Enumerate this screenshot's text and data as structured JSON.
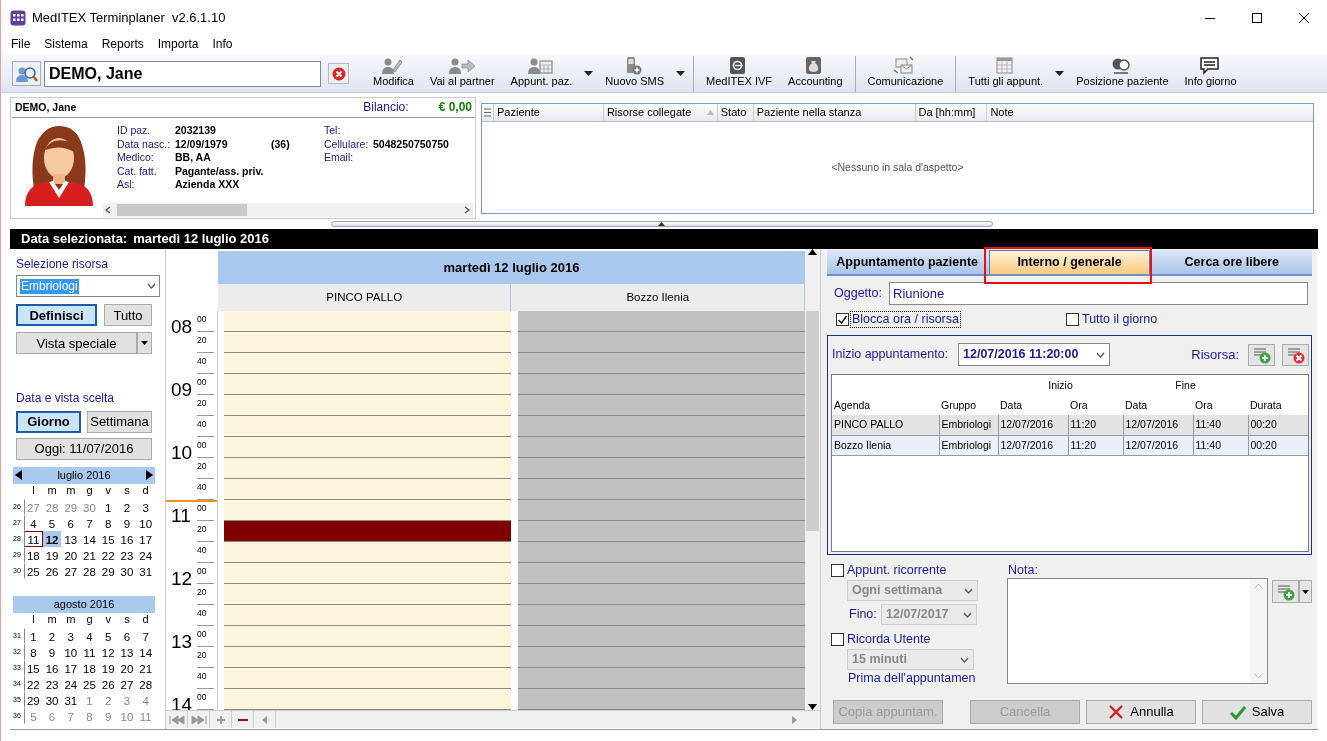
{
  "window": {
    "title": "MedITEX Terminplaner  v2.6.1.10"
  },
  "menu": [
    "File",
    "Sistema",
    "Reports",
    "Importa",
    "Info"
  ],
  "search": {
    "value": "DEMO, Jane"
  },
  "toolbar": [
    {
      "buttons": [
        {
          "label": "Modifica",
          "dropdown": false
        },
        {
          "label": "Vai al partner",
          "dropdown": false
        },
        {
          "label": "Appunt. paz.",
          "dropdown": true
        },
        {
          "label": "Nuovo SMS",
          "dropdown": true
        }
      ]
    },
    {
      "buttons": [
        {
          "label": "MedITEX IVF",
          "dropdown": false
        },
        {
          "label": "Accounting",
          "dropdown": false
        }
      ]
    },
    {
      "buttons": [
        {
          "label": "Comunicazione",
          "dropdown": false
        }
      ]
    },
    {
      "buttons": [
        {
          "label": "Tutti gli appunt.",
          "dropdown": true
        },
        {
          "label": "Posizione paziente",
          "dropdown": false
        },
        {
          "label": "Info giorno",
          "dropdown": false
        }
      ]
    }
  ],
  "patient": {
    "name": "DEMO, Jane",
    "balance_label": "Bilancio:",
    "balance": "€ 0,00",
    "details": [
      {
        "label": "ID paz.",
        "value": "2032139"
      },
      {
        "label": "Data nasc.:",
        "value": "12/09/1979",
        "extra": "(36)"
      },
      {
        "label": "Medico:",
        "value": "BB, AA"
      },
      {
        "label": "Cat. fatt.",
        "value": "Pagante/ass. priv."
      },
      {
        "label": "Asl:",
        "value": "Azienda XXX"
      }
    ],
    "contacts": [
      {
        "label": "Tel:"
      },
      {
        "label": "Cellulare:",
        "value": "5048250750750"
      },
      {
        "label": "Email:"
      }
    ]
  },
  "waiting_room": {
    "columns": [
      {
        "label": "Paziente",
        "sorted": false
      },
      {
        "label": "Risorse collegate",
        "sorted": true
      },
      {
        "label": "Stato",
        "sorted": false
      },
      {
        "label": "Paziente nella stanza",
        "sorted": false
      },
      {
        "label": "Da [hh:mm]",
        "sorted": false
      },
      {
        "label": "Note",
        "sorted": false
      }
    ],
    "empty_text": "<Nessuno in sala d'aspetto>"
  },
  "selected_date": {
    "label": "Data selezionata:",
    "value": "martedì 12 luglio 2016"
  },
  "resource_panel": {
    "heading": "Selezione risorsa",
    "select": "Embriologi",
    "buttons": [
      {
        "label": "Definisci",
        "selected": true
      },
      {
        "label": "Tutto",
        "selected": false
      }
    ],
    "special_view": "Vista speciale"
  },
  "view_panel": {
    "heading": "Data e vista scelta",
    "views": [
      {
        "label": "Giorno",
        "selected": true
      },
      {
        "label": "Settimana",
        "selected": false
      }
    ],
    "today": "Oggi: 11/07/2016"
  },
  "calendars": [
    {
      "title": "luglio 2016",
      "nav": true,
      "weekdays": [
        "l",
        "m",
        "m",
        "g",
        "v",
        "s",
        "d"
      ],
      "weeks": [
        {
          "week": "26",
          "days": [
            {
              "d": "27",
              "muted": true,
              "today": false,
              "selected": false
            },
            {
              "d": "28",
              "muted": true,
              "today": false,
              "selected": false
            },
            {
              "d": "29",
              "muted": true,
              "today": false,
              "selected": false
            },
            {
              "d": "30",
              "muted": true,
              "today": false,
              "selected": false
            },
            {
              "d": "1",
              "muted": false,
              "today": false,
              "selected": false
            },
            {
              "d": "2",
              "muted": false,
              "today": false,
              "selected": false
            },
            {
              "d": "3",
              "muted": false,
              "today": false,
              "selected": false
            }
          ]
        },
        {
          "week": "27",
          "days": [
            {
              "d": "4",
              "muted": false,
              "today": false,
              "selected": false
            },
            {
              "d": "5",
              "muted": false,
              "today": false,
              "selected": false
            },
            {
              "d": "6",
              "muted": false,
              "today": false,
              "selected": false
            },
            {
              "d": "7",
              "muted": false,
              "today": false,
              "selected": false
            },
            {
              "d": "8",
              "muted": false,
              "today": false,
              "selected": false
            },
            {
              "d": "9",
              "muted": false,
              "today": false,
              "selected": false
            },
            {
              "d": "10",
              "muted": false,
              "today": false,
              "selected": false
            }
          ]
        },
        {
          "week": "28",
          "days": [
            {
              "d": "11",
              "muted": false,
              "today": true,
              "selected": false
            },
            {
              "d": "12",
              "muted": false,
              "today": false,
              "selected": true
            },
            {
              "d": "13",
              "muted": false,
              "today": false,
              "selected": false
            },
            {
              "d": "14",
              "muted": false,
              "today": false,
              "selected": false
            },
            {
              "d": "15",
              "muted": false,
              "today": false,
              "selected": false
            },
            {
              "d": "16",
              "muted": false,
              "today": false,
              "selected": false
            },
            {
              "d": "17",
              "muted": false,
              "today": false,
              "selected": false
            }
          ]
        },
        {
          "week": "29",
          "days": [
            {
              "d": "18",
              "muted": false,
              "today": false,
              "selected": false
            },
            {
              "d": "19",
              "muted": false,
              "today": false,
              "selected": false
            },
            {
              "d": "20",
              "muted": false,
              "today": false,
              "selected": false
            },
            {
              "d": "21",
              "muted": false,
              "today": false,
              "selected": false
            },
            {
              "d": "22",
              "muted": false,
              "today": false,
              "selected": false
            },
            {
              "d": "23",
              "muted": false,
              "today": false,
              "selected": false
            },
            {
              "d": "24",
              "muted": false,
              "today": false,
              "selected": false
            }
          ]
        },
        {
          "week": "30",
          "days": [
            {
              "d": "25",
              "muted": false,
              "today": false,
              "selected": false
            },
            {
              "d": "26",
              "muted": false,
              "today": false,
              "selected": false
            },
            {
              "d": "27",
              "muted": false,
              "today": false,
              "selected": false
            },
            {
              "d": "28",
              "muted": false,
              "today": false,
              "selected": false
            },
            {
              "d": "29",
              "muted": false,
              "today": false,
              "selected": false
            },
            {
              "d": "30",
              "muted": false,
              "today": false,
              "selected": false
            },
            {
              "d": "31",
              "muted": false,
              "today": false,
              "selected": false
            }
          ]
        }
      ]
    },
    {
      "title": "agosto 2016",
      "nav": false,
      "weekdays": [
        "l",
        "m",
        "m",
        "g",
        "v",
        "s",
        "d"
      ],
      "weeks": [
        {
          "week": "31",
          "days": [
            {
              "d": "1",
              "muted": false,
              "today": false,
              "selected": false
            },
            {
              "d": "2",
              "muted": false,
              "today": false,
              "selected": false
            },
            {
              "d": "3",
              "muted": false,
              "today": false,
              "selected": false
            },
            {
              "d": "4",
              "muted": false,
              "today": false,
              "selected": false
            },
            {
              "d": "5",
              "muted": false,
              "today": false,
              "selected": false
            },
            {
              "d": "6",
              "muted": false,
              "today": false,
              "selected": false
            },
            {
              "d": "7",
              "muted": false,
              "today": false,
              "selected": false
            }
          ]
        },
        {
          "week": "32",
          "days": [
            {
              "d": "8",
              "muted": false,
              "today": false,
              "selected": false
            },
            {
              "d": "9",
              "muted": false,
              "today": false,
              "selected": false
            },
            {
              "d": "10",
              "muted": false,
              "today": false,
              "selected": false
            },
            {
              "d": "11",
              "muted": false,
              "today": false,
              "selected": false
            },
            {
              "d": "12",
              "muted": false,
              "today": false,
              "selected": false
            },
            {
              "d": "13",
              "muted": false,
              "today": false,
              "selected": false
            },
            {
              "d": "14",
              "muted": false,
              "today": false,
              "selected": false
            }
          ]
        },
        {
          "week": "33",
          "days": [
            {
              "d": "15",
              "muted": false,
              "today": false,
              "selected": false
            },
            {
              "d": "16",
              "muted": false,
              "today": false,
              "selected": false
            },
            {
              "d": "17",
              "muted": false,
              "today": false,
              "selected": false
            },
            {
              "d": "18",
              "muted": false,
              "today": false,
              "selected": false
            },
            {
              "d": "19",
              "muted": false,
              "today": false,
              "selected": false
            },
            {
              "d": "20",
              "muted": false,
              "today": false,
              "selected": false
            },
            {
              "d": "21",
              "muted": false,
              "today": false,
              "selected": false
            }
          ]
        },
        {
          "week": "34",
          "days": [
            {
              "d": "22",
              "muted": false,
              "today": false,
              "selected": false
            },
            {
              "d": "23",
              "muted": false,
              "today": false,
              "selected": false
            },
            {
              "d": "24",
              "muted": false,
              "today": false,
              "selected": false
            },
            {
              "d": "25",
              "muted": false,
              "today": false,
              "selected": false
            },
            {
              "d": "26",
              "muted": false,
              "today": false,
              "selected": false
            },
            {
              "d": "27",
              "muted": false,
              "today": false,
              "selected": false
            },
            {
              "d": "28",
              "muted": false,
              "today": false,
              "selected": false
            }
          ]
        },
        {
          "week": "35",
          "days": [
            {
              "d": "29",
              "muted": false,
              "today": false,
              "selected": false
            },
            {
              "d": "30",
              "muted": false,
              "today": false,
              "selected": false
            },
            {
              "d": "31",
              "muted": false,
              "today": false,
              "selected": false
            },
            {
              "d": "1",
              "muted": true,
              "today": false,
              "selected": false
            },
            {
              "d": "2",
              "muted": true,
              "today": false,
              "selected": false
            },
            {
              "d": "3",
              "muted": true,
              "today": false,
              "selected": false
            },
            {
              "d": "4",
              "muted": true,
              "today": false,
              "selected": false
            }
          ]
        },
        {
          "week": "36",
          "days": [
            {
              "d": "5",
              "muted": true,
              "today": false,
              "selected": false
            },
            {
              "d": "6",
              "muted": true,
              "today": false,
              "selected": false
            },
            {
              "d": "7",
              "muted": true,
              "today": false,
              "selected": false
            },
            {
              "d": "8",
              "muted": true,
              "today": false,
              "selected": false
            },
            {
              "d": "9",
              "muted": true,
              "today": false,
              "selected": false
            },
            {
              "d": "10",
              "muted": true,
              "today": false,
              "selected": false
            },
            {
              "d": "11",
              "muted": true,
              "today": false,
              "selected": false
            }
          ]
        }
      ]
    }
  ],
  "schedule": {
    "title": "martedì 12 luglio 2016",
    "resources": [
      {
        "name": "PINCO PALLO",
        "available": true
      },
      {
        "name": "Bozzo Ilenia",
        "available": false
      }
    ],
    "hours": [
      {
        "hour": "08",
        "current": false,
        "minutes": [
          {
            "m": "00",
            "booked": [
              false,
              false
            ]
          },
          {
            "m": "20",
            "booked": [
              false,
              false
            ]
          },
          {
            "m": "40",
            "booked": [
              false,
              false
            ]
          }
        ]
      },
      {
        "hour": "09",
        "current": false,
        "minutes": [
          {
            "m": "00",
            "booked": [
              false,
              false
            ]
          },
          {
            "m": "20",
            "booked": [
              false,
              false
            ]
          },
          {
            "m": "40",
            "booked": [
              false,
              false
            ]
          }
        ]
      },
      {
        "hour": "10",
        "current": false,
        "minutes": [
          {
            "m": "00",
            "booked": [
              false,
              false
            ]
          },
          {
            "m": "20",
            "booked": [
              false,
              false
            ]
          },
          {
            "m": "40",
            "booked": [
              false,
              false
            ]
          }
        ]
      },
      {
        "hour": "11",
        "current": true,
        "minutes": [
          {
            "m": "00",
            "booked": [
              false,
              false
            ]
          },
          {
            "m": "20",
            "booked": [
              true,
              false
            ]
          },
          {
            "m": "40",
            "booked": [
              false,
              false
            ]
          }
        ]
      },
      {
        "hour": "12",
        "current": false,
        "minutes": [
          {
            "m": "00",
            "booked": [
              false,
              false
            ]
          },
          {
            "m": "20",
            "booked": [
              false,
              false
            ]
          },
          {
            "m": "40",
            "booked": [
              false,
              false
            ]
          }
        ]
      },
      {
        "hour": "13",
        "current": false,
        "minutes": [
          {
            "m": "00",
            "booked": [
              false,
              false
            ]
          },
          {
            "m": "20",
            "booked": [
              false,
              false
            ]
          },
          {
            "m": "40",
            "booked": [
              false,
              false
            ]
          }
        ]
      },
      {
        "hour": "14",
        "current": false,
        "minutes": [
          {
            "m": "00",
            "booked": [
              false,
              false
            ]
          }
        ]
      }
    ]
  },
  "form": {
    "tabs": [
      {
        "label": "Appuntamento paziente",
        "selected": false,
        "highlighted": false
      },
      {
        "label": "Interno / generale",
        "selected": true,
        "highlighted": true
      },
      {
        "label": "Cerca ore libere",
        "selected": false,
        "highlighted": false
      }
    ],
    "subject_label": "Oggetto:",
    "subject": "Riunione",
    "options": [
      {
        "label": "Blocca ora / risorsa",
        "checked": true,
        "focused": true
      },
      {
        "label": "Tutto il giorno",
        "checked": false,
        "focused": false
      }
    ],
    "start_label": "Inizio appuntamento:",
    "start": "12/07/2016 11:20:00",
    "resource_label": "Risorsa:",
    "resource_table": {
      "groups": [
        "Inizio",
        "Fine"
      ],
      "columns": [
        "Agenda",
        "Gruppo",
        "Data",
        "Ora",
        "Data",
        "Ora",
        "Durata"
      ],
      "rows": [
        {
          "cells": [
            "PINCO PALLO",
            "Embriologi",
            "12/07/2016",
            "11:20",
            "12/07/2016",
            "11:40",
            "00:20"
          ],
          "selected": false
        },
        {
          "cells": [
            "Bozzo Ilenia",
            "Embriologi",
            "12/07/2016",
            "11:20",
            "12/07/2016",
            "11:40",
            "00:20"
          ],
          "selected": true
        }
      ]
    },
    "recurring": {
      "label": "Appunt. ricorrente",
      "checked": false,
      "frequency": "Ogni settimana",
      "until_label": "Fino:",
      "until": "12/07/2017"
    },
    "reminder": {
      "label": "Ricorda Utente",
      "checked": false,
      "lead": "15 minuti",
      "note": "Prima dell'appuntamen"
    },
    "note_label": "Nota:",
    "actions": [
      {
        "label": "Copia appuntam.",
        "disabled": true
      },
      {
        "label": "Cancella",
        "disabled": true
      },
      {
        "label": "Annulla",
        "disabled": false
      },
      {
        "label": "Salva",
        "disabled": false
      }
    ]
  }
}
